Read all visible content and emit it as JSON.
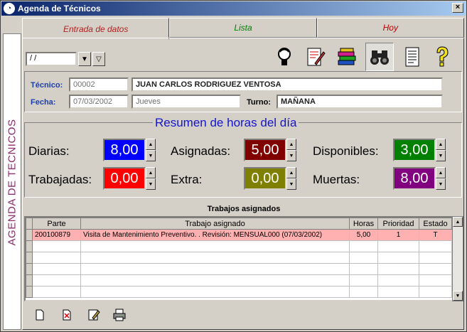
{
  "window": {
    "title": "Agenda de Técnicos",
    "close_label": "×"
  },
  "sidebar": {
    "label": "AGENDA DE TECNICOS"
  },
  "tabs": [
    {
      "label": "Entrada de datos"
    },
    {
      "label": "Lista"
    },
    {
      "label": "Hoy"
    }
  ],
  "date_filter": {
    "value": " / /",
    "dropdown_glyph": "▼",
    "filter_glyph": "▽"
  },
  "tecnico": {
    "label": "Técnico:",
    "code": "00002",
    "name": "JUAN CARLOS RODRIGUEZ VENTOSA"
  },
  "fecha": {
    "label": "Fecha:",
    "date": "07/03/2002",
    "weekday": "Jueves"
  },
  "turno": {
    "label": "Turno:",
    "value": "MAÑANA"
  },
  "resumen": {
    "title": "Resumen de horas del día",
    "diarias": {
      "label": "Diarias:",
      "value": "8,00",
      "color": "#0000ff"
    },
    "asignadas": {
      "label": "Asignadas:",
      "value": "5,00",
      "color": "#800000"
    },
    "disponibles": {
      "label": "Disponibles:",
      "value": "3,00",
      "color": "#008000"
    },
    "trabajadas": {
      "label": "Trabajadas:",
      "value": "0,00",
      "color": "#ff0000"
    },
    "extra": {
      "label": "Extra:",
      "value": "0,00",
      "color": "#808000"
    },
    "muertas": {
      "label": "Muertas:",
      "value": "8,00",
      "color": "#800080"
    }
  },
  "trabajos": {
    "title": "Trabajos asignados",
    "columns": [
      "Parte",
      "Trabajo asignado",
      "Horas",
      "Prioridad",
      "Estado"
    ],
    "rows": [
      {
        "parte": "200100879",
        "trabajo": "Visita de Mantenimiento Preventivo. . Revisión: MENSUAL000 (07/03/2002)",
        "horas": "5,00",
        "prioridad": "1",
        "estado": "T"
      }
    ]
  },
  "icons": {
    "toolbar": [
      "person-icon",
      "form-edit-icon",
      "books-icon",
      "binoculars-icon",
      "document-icon",
      "help-icon"
    ],
    "bottom": [
      "new-document-icon",
      "delete-document-icon",
      "edit-document-icon",
      "print-icon"
    ]
  }
}
